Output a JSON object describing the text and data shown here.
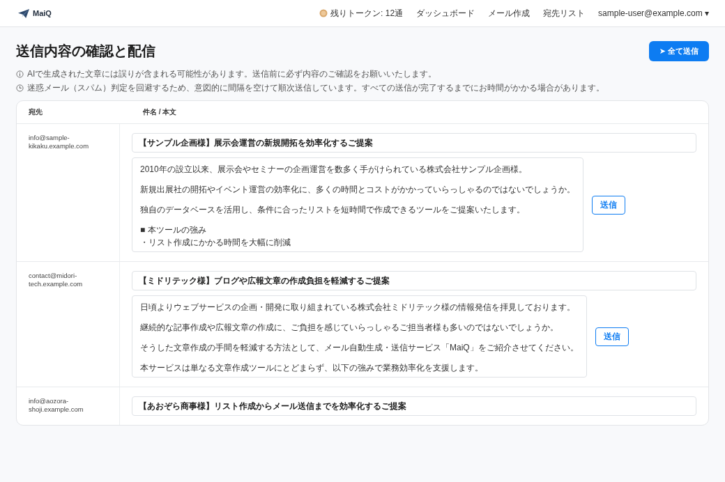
{
  "header": {
    "logo": "MaiQ",
    "tokens": "残りトークン: 12通",
    "nav": [
      {
        "label": "ダッシュボード"
      },
      {
        "label": "メール作成"
      },
      {
        "label": "宛先リスト"
      }
    ],
    "user": "sample-user@example.com ▾"
  },
  "page": {
    "title": "送信内容の確認と配信",
    "send_all": "➤ 全て送信",
    "notices": [
      {
        "kind": "info",
        "text": "AIで生成された文章には誤りが含まれる可能性があります。送信前に必ず内容のご確認をお願いいたします。"
      },
      {
        "kind": "clock",
        "text": "迷惑メール（スパム）判定を回避するため、意図的に間隔を空けて順次送信しています。すべての送信が完了するまでにお時間がかかる場合があります。"
      }
    ]
  },
  "table": {
    "columns": [
      "宛先",
      "件名 / 本文"
    ],
    "rows": [
      {
        "recipient": "info@sample-kikaku.example.com",
        "subject": "【サンプル企画様】展示会運営の新規開拓を効率化するご提案",
        "send": "送信",
        "body": [
          [
            "2010年の設立以来、展示会やセミナーの企画運営を数多く手がけられている株式会社サンプル企画様。"
          ],
          [
            "新規出展社の開拓やイベント運営の効率化に、多くの時間とコストがかかっていらっしゃるのではないでしょうか。"
          ],
          [
            "独自のデータベースを活用し、条件に合ったリストを短時間で作成できるツールをご提案いたします。"
          ],
          [
            "■ 本ツールの強み",
            "・リスト作成にかかる時間を大幅に削減"
          ]
        ]
      },
      {
        "recipient": "contact@midori-tech.example.com",
        "subject": "【ミドリテック様】ブログや広報文章の作成負担を軽減するご提案",
        "send": "送信",
        "body": [
          [
            "日頃よりウェブサービスの企画・開発に取り組まれている株式会社ミドリテック様の情報発信を拝見しております。"
          ],
          [
            "継続的な記事作成や広報文章の作成に、ご負担を感じていらっしゃるご担当者様も多いのではないでしょうか。"
          ],
          [
            "そうした文章作成の手間を軽減する方法として、メール自動生成・送信サービス「MaiQ」をご紹介させてください。"
          ],
          [
            "本サービスは単なる文章作成ツールにとどまらず、以下の強みで業務効率化を支援します。"
          ]
        ]
      },
      {
        "recipient": "info@aozora-shoji.example.com",
        "subject": "【あおぞら商事様】リスト作成からメール送信までを効率化するご提案"
      }
    ]
  }
}
